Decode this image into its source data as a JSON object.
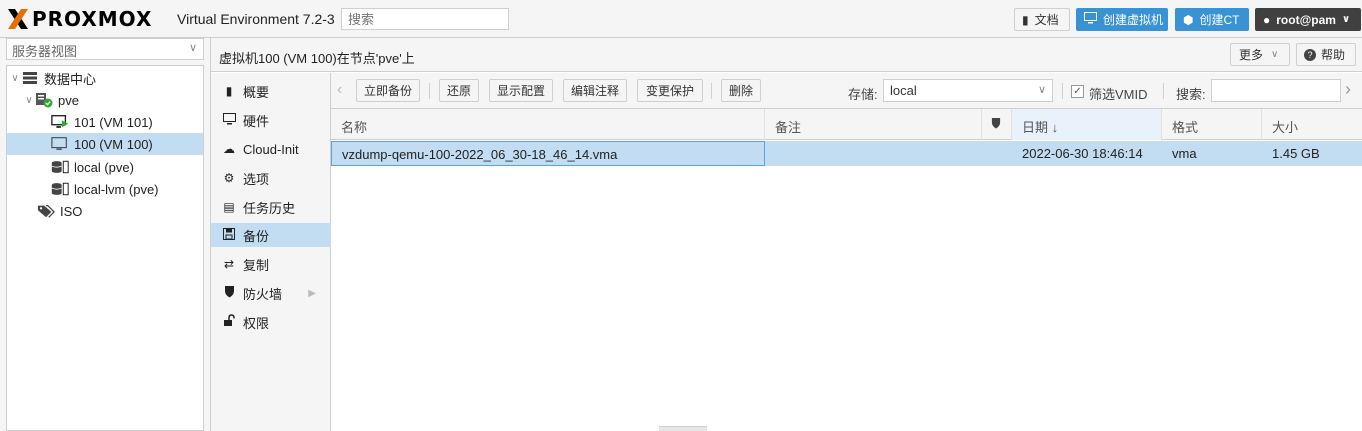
{
  "header": {
    "logo_text": "PROXMOX",
    "version_title": "Virtual Environment 7.2-3",
    "search_placeholder": "搜索",
    "docs_label": "文档",
    "create_vm_label": "创建虚拟机",
    "create_ct_label": "创建CT",
    "user_label": "root@pam"
  },
  "sidebar": {
    "view_label": "服务器视图",
    "tree": [
      {
        "label": "数据中心",
        "icon": "datacenter-icon"
      },
      {
        "label": "pve",
        "icon": "node-online-icon"
      },
      {
        "label": "101 (VM 101)",
        "icon": "vm-running-icon"
      },
      {
        "label": "100 (VM 100)",
        "icon": "vm-stopped-icon",
        "selected": true
      },
      {
        "label": "local (pve)",
        "icon": "storage-icon"
      },
      {
        "label": "local-lvm (pve)",
        "icon": "storage-icon"
      },
      {
        "label": "ISO",
        "icon": "tags-icon"
      }
    ]
  },
  "main": {
    "title": "虚拟机100 (VM 100)在节点'pve'上",
    "more_label": "更多",
    "help_label": "帮助",
    "menu": [
      {
        "label": "概要",
        "icon": "book-icon"
      },
      {
        "label": "硬件",
        "icon": "desktop-icon"
      },
      {
        "label": "Cloud-Init",
        "icon": "cloud-icon"
      },
      {
        "label": "选项",
        "icon": "gear-icon"
      },
      {
        "label": "任务历史",
        "icon": "list-icon"
      },
      {
        "label": "备份",
        "icon": "floppy-icon",
        "selected": true
      },
      {
        "label": "复制",
        "icon": "retweet-icon"
      },
      {
        "label": "防火墙",
        "icon": "shield-icon"
      },
      {
        "label": "权限",
        "icon": "unlock-icon"
      }
    ],
    "toolbar": {
      "backup_now": "立即备份",
      "restore": "还原",
      "show_config": "显示配置",
      "edit_notes": "编辑注释",
      "change_protection": "变更保护",
      "delete": "删除",
      "storage_label": "存储:",
      "storage_value": "local",
      "filter_vmid_label": "筛选VMID",
      "search_label": "搜索:"
    },
    "grid": {
      "columns": [
        "名称",
        "备注",
        "",
        "日期 ↓",
        "格式",
        "大小"
      ],
      "rows": [
        {
          "name": "vzdump-qemu-100-2022_06_30-18_46_14.vma",
          "notes": "",
          "protected": "",
          "date": "2022-06-30 18:46:14",
          "format": "vma",
          "size": "1.45 GB"
        }
      ]
    }
  }
}
